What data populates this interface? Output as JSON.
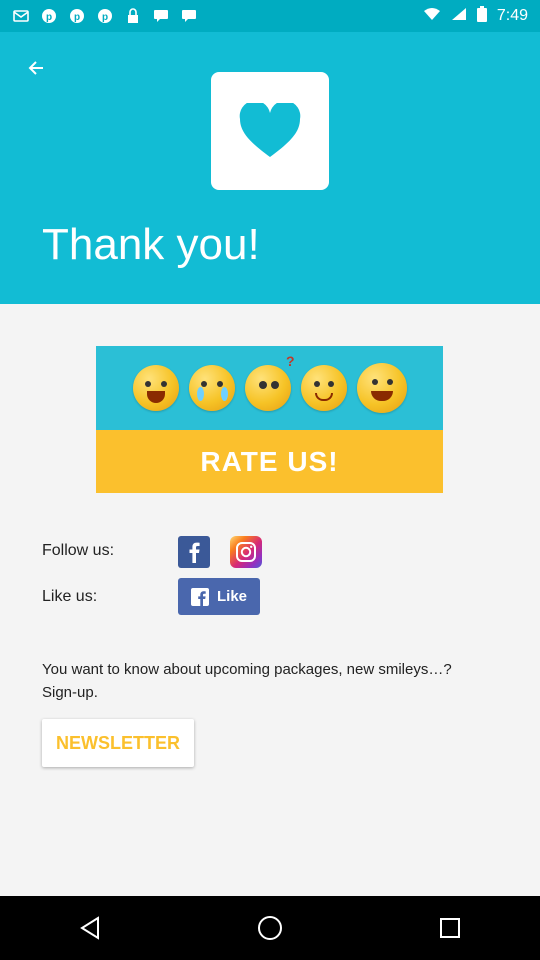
{
  "status_bar": {
    "time": "7:49",
    "icons": [
      "gmail-icon",
      "pinterest-icon",
      "pinterest-icon",
      "pinterest-icon",
      "lock-icon",
      "message-icon",
      "message-icon",
      "wifi-icon",
      "signal-icon",
      "battery-icon"
    ]
  },
  "header": {
    "title": "Thank you!",
    "colors": {
      "teal": "#12bcd4",
      "status": "#00acc1"
    }
  },
  "rate": {
    "label": "RATE US!",
    "colors": {
      "top": "#2bbfd6",
      "bottom": "#fbc02d"
    }
  },
  "social": {
    "follow_label": "Follow us:",
    "like_label": "Like us:",
    "like_button": "Like"
  },
  "newsletter": {
    "text": "You want to know about upcoming packages, new smileys…? Sign-up.",
    "button": "NEWSLETTER"
  }
}
